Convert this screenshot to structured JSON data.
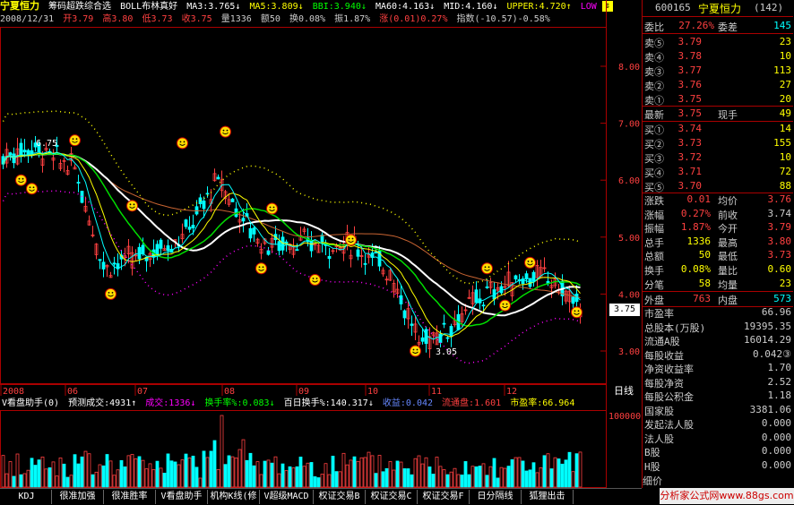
{
  "header": {
    "stock_name": "宁夏恒力",
    "indicator_name": "筹码超跌综合选",
    "boll_name": "BOLL布林真好",
    "ma3": "MA3:3.765↓",
    "ma5": "MA5:3.809↓",
    "bbi": "BBI:3.940↓",
    "ma60": "MA60:4.163↓",
    "mid": "MID:4.160↓",
    "upper": "UPPER:4.720↑",
    "low": "LOW",
    "date": "2008/12/31",
    "open": "开3.79",
    "high": "高3.80",
    "low_price": "低3.73",
    "close": "收3.75",
    "volume": "量1336",
    "amount": "额50",
    "turnover": "换0.08%",
    "amplitude": "振1.87%",
    "change": "涨(0.01)0.27%",
    "index": "指数(-10.57)-0.58%"
  },
  "price_axis": {
    "ticks": [
      "8.00",
      "7.00",
      "6.00",
      "5.00",
      "4.00",
      "3.00"
    ],
    "current_price_tag": "3.75"
  },
  "annotations": {
    "high_label": "6.75",
    "low_label": "3.05"
  },
  "time_axis": {
    "labels": [
      "2008",
      "06",
      "07",
      "08",
      "09",
      "10",
      "11",
      "12"
    ],
    "period": "日线"
  },
  "lower_header": {
    "name": "V看盘助手(0)",
    "forecast": "预测成交:4931↑",
    "volume": "成交:1336↓",
    "turnover": "换手率%:0.083↓",
    "hundred_day": "百日换手%:140.317↓",
    "profit": "收益:0.042",
    "float": "流通盘:1.601",
    "pe": "市盈率:66.964"
  },
  "volume_axis": {
    "max_label": "100000"
  },
  "right_panel": {
    "code": "600165",
    "name": "宁夏恒力",
    "count": "(142)",
    "weibi_label": "委比",
    "weibi_value": "27.26%",
    "weicha_label": "委差",
    "weicha_value": "145",
    "sells": [
      {
        "label": "卖⑤",
        "price": "3.79",
        "vol": "23"
      },
      {
        "label": "卖④",
        "price": "3.78",
        "vol": "10"
      },
      {
        "label": "卖③",
        "price": "3.77",
        "vol": "113"
      },
      {
        "label": "卖②",
        "price": "3.76",
        "vol": "27"
      },
      {
        "label": "卖①",
        "price": "3.75",
        "vol": "20"
      }
    ],
    "latest_label": "最新",
    "latest_value": "3.75",
    "hand_label": "现手",
    "hand_value": "49",
    "buys": [
      {
        "label": "买①",
        "price": "3.74",
        "vol": "14"
      },
      {
        "label": "买②",
        "price": "3.73",
        "vol": "155"
      },
      {
        "label": "买③",
        "price": "3.72",
        "vol": "10"
      },
      {
        "label": "买④",
        "price": "3.71",
        "vol": "72"
      },
      {
        "label": "买⑤",
        "price": "3.70",
        "vol": "88"
      }
    ],
    "stats": [
      {
        "l1": "涨跌",
        "v1": "0.01",
        "l2": "均价",
        "v2": "3.76"
      },
      {
        "l1": "涨幅",
        "v1": "0.27%",
        "l2": "前收",
        "v2": "3.74"
      },
      {
        "l1": "振幅",
        "v1": "1.87%",
        "l2": "今开",
        "v2": "3.79"
      },
      {
        "l1": "总手",
        "v1": "1336",
        "l2": "最高",
        "v2": "3.80"
      },
      {
        "l1": "总额",
        "v1": "50",
        "l2": "最低",
        "v2": "3.73"
      },
      {
        "l1": "换手",
        "v1": "0.08%",
        "l2": "量比",
        "v2": "0.60"
      },
      {
        "l1": "分笔",
        "v1": "58",
        "l2": "均量",
        "v2": "23"
      }
    ],
    "outer_label": "外盘",
    "outer_value": "763",
    "inner_label": "内盘",
    "inner_value": "573",
    "fundamentals": [
      {
        "label": "市盈率",
        "value": "66.96"
      },
      {
        "label": "总股本(万股)",
        "value": "19395.35"
      },
      {
        "label": "流通A股",
        "value": "16014.29"
      },
      {
        "label": "每股收益",
        "value": "0.042③"
      },
      {
        "label": "净资收益率",
        "value": "1.70"
      },
      {
        "label": "每股净资",
        "value": "2.52"
      },
      {
        "label": "每股公积金",
        "value": "1.18"
      },
      {
        "label": "国家股",
        "value": "3381.06"
      },
      {
        "label": "发起法人股",
        "value": "0.000"
      },
      {
        "label": "法人股",
        "value": "0.000"
      },
      {
        "label": "B股",
        "value": "0.000"
      },
      {
        "label": "H股",
        "value": "0.000"
      }
    ],
    "footer": "细价"
  },
  "tabs": [
    "KDJ",
    "很准加强",
    "很准胜率",
    "V看盘助手",
    "机构K线(修",
    "V超级MACD",
    "权证交易B",
    "权证交易C",
    "权证交易F",
    "日分隔线",
    "狐狸出击"
  ],
  "ad_text": "分析家公式网www.88gs.com",
  "colors": {
    "up": "#ff4040",
    "down": "#00ffff",
    "yellow": "#ffff00",
    "magenta": "#ff00ff",
    "green": "#00dd00",
    "white": "#ffffff"
  }
}
